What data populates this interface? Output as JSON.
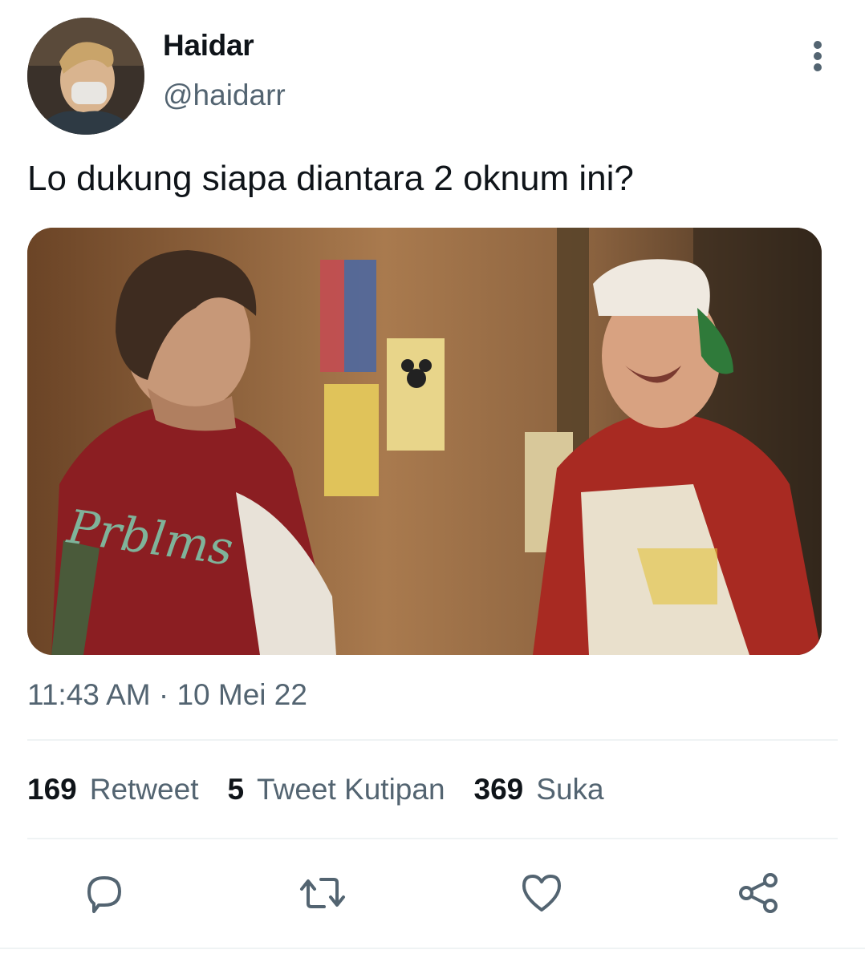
{
  "tweet": {
    "author_name": "Haidar",
    "author_handle": "@haidarr",
    "text": "Lo dukung siapa diantara 2 oknum ini?",
    "timestamp": "11:43 AM · 10 Mei 22"
  },
  "stats": [
    {
      "count": "169",
      "label": "Retweet"
    },
    {
      "count": "5",
      "label": "Tweet Kutipan"
    },
    {
      "count": "369",
      "label": "Suka"
    }
  ],
  "media": {
    "jacket_text": "Prblms"
  },
  "icons": {
    "more": "more-vertical-icon",
    "reply": "reply-icon",
    "retweet": "retweet-icon",
    "like": "heart-icon",
    "share": "share-icon"
  },
  "colors": {
    "text_primary": "#0f1419",
    "text_secondary": "#536471",
    "divider": "#eff3f4"
  }
}
